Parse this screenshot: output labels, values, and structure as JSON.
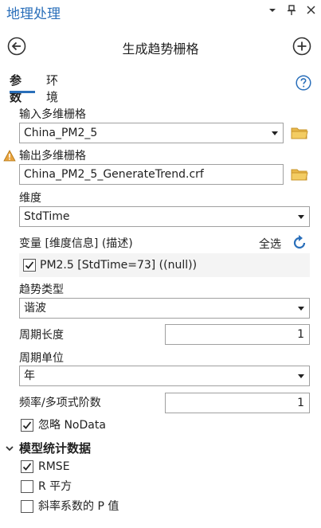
{
  "pane": {
    "title": "地理处理"
  },
  "tool": {
    "title": "生成趋势栅格"
  },
  "tabs": [
    {
      "label": "参数"
    },
    {
      "label": "环境"
    }
  ],
  "params": {
    "input_label": "输入多维栅格",
    "input_value": "China_PM2_5",
    "output_label": "输出多维栅格",
    "output_value": "China_PM2_5_GenerateTrend.crf",
    "dimension_label": "维度",
    "dimension_value": "StdTime",
    "variable_label": "变量 [维度信息]  (描述)",
    "select_all": "全选",
    "variable_item": "PM2.5 [StdTime=73] ((null))",
    "trend_type_label": "趋势类型",
    "trend_type_value": "谐波",
    "cycle_length_label": "周期长度",
    "cycle_length_value": "1",
    "cycle_unit_label": "周期单位",
    "cycle_unit_value": "年",
    "frequency_label": "频率/多项式阶数",
    "frequency_value": "1",
    "ignore_nodata_label": "忽略 NoData"
  },
  "model_stats": {
    "header": "模型统计数据",
    "items": [
      {
        "label": "RMSE",
        "checked": true
      },
      {
        "label": "R 平方",
        "checked": false
      },
      {
        "label": "斜率系数的 P 值",
        "checked": false
      }
    ]
  },
  "colors": {
    "accent": "#2a6fba",
    "warning": "#e8a33d",
    "folder": "#e8b84a"
  },
  "icons": [
    "pin-icon",
    "close-icon",
    "back-icon",
    "add-icon",
    "help-icon",
    "warning-icon",
    "folder-icon",
    "refresh-icon",
    "checkmark-icon",
    "chevron-down-icon"
  ]
}
